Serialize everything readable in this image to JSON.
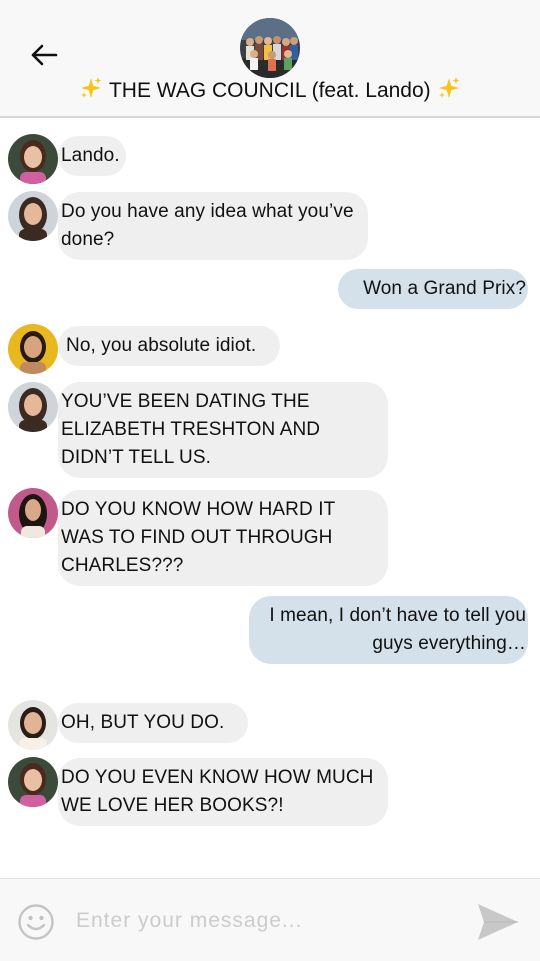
{
  "header": {
    "title": "THE WAG COUNCIL (feat. Lando)",
    "sparkle_left": "sparkle-icon",
    "sparkle_right": "sparkle-icon",
    "back_icon": "back-arrow-icon"
  },
  "messages": [
    {
      "direction": "incoming",
      "avatar": "avatar-brunette-1",
      "text": "Lando."
    },
    {
      "direction": "incoming",
      "avatar": "avatar-brunette-2",
      "text": "Do you have any idea what you’ve done?"
    },
    {
      "direction": "outgoing",
      "text": "Won a Grand Prix?"
    },
    {
      "direction": "incoming",
      "avatar": "avatar-yellow",
      "text": "No, you absolute idiot."
    },
    {
      "direction": "incoming",
      "avatar": "avatar-brunette-2",
      "text": "YOU’VE BEEN DATING THE ELIZABETH TRESHTON AND DIDN’T TELL US."
    },
    {
      "direction": "incoming",
      "avatar": "avatar-brunette-3",
      "text": "DO YOU KNOW HOW HARD IT WAS TO FIND OUT THROUGH CHARLES???"
    },
    {
      "direction": "outgoing",
      "text": "I mean, I don’t have to tell you guys everything…"
    },
    {
      "direction": "incoming",
      "avatar": "avatar-brunette-4",
      "text": "OH, BUT YOU DO."
    },
    {
      "direction": "incoming",
      "avatar": "avatar-brunette-1",
      "text": "DO YOU EVEN KNOW HOW MUCH WE LOVE HER BOOKS?!"
    }
  ],
  "composer": {
    "placeholder": "Enter your message...",
    "value": "",
    "emoji_icon": "smiley-icon",
    "send_icon": "send-icon"
  },
  "colors": {
    "incoming_bubble": "#efefef",
    "outgoing_bubble": "#d4e1eb",
    "header_bg": "#f8f8f8"
  }
}
